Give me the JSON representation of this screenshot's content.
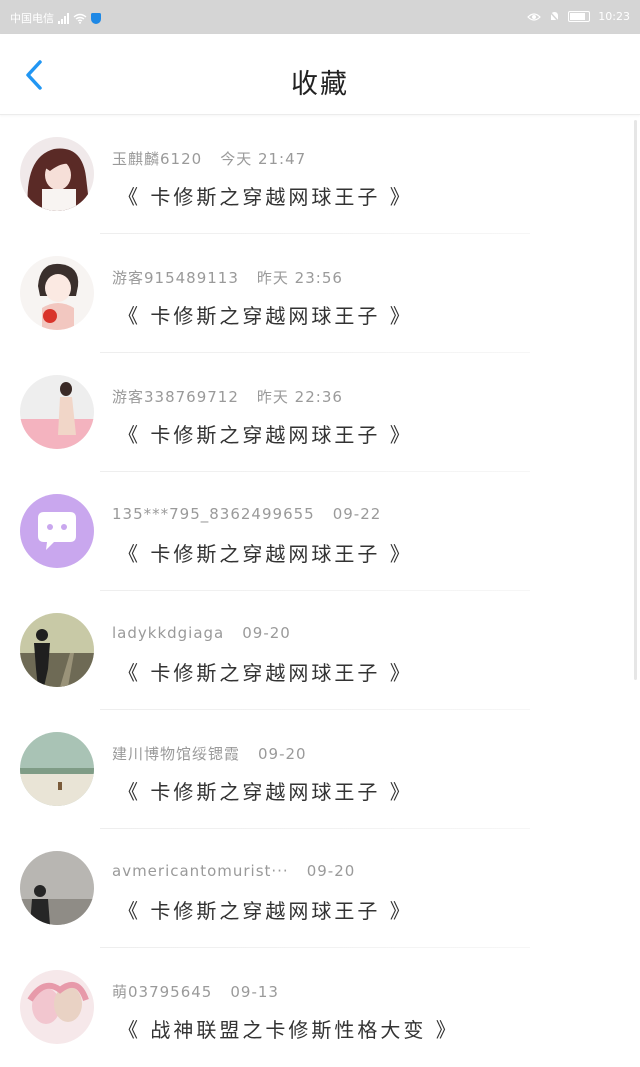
{
  "status_bar": {
    "carrier": "中国电信",
    "time": "10:23"
  },
  "header": {
    "title": "收藏"
  },
  "favorites": [
    {
      "user": "玉麒麟6120",
      "time": "今天 21:47",
      "book": "《 卡修斯之穿越网球王子 》",
      "avatar": "avatar-girl-brown-hair"
    },
    {
      "user": "游客915489113",
      "time": "昨天 23:56",
      "book": "《 卡修斯之穿越网球王子 》",
      "avatar": "avatar-anime-girl"
    },
    {
      "user": "游客338769712",
      "time": "昨天 22:36",
      "book": "《 卡修斯之穿越网球王子 》",
      "avatar": "avatar-girl-pink-text"
    },
    {
      "user": "135***795_8362499655",
      "time": "09-22",
      "book": "《 卡修斯之穿越网球王子 》",
      "avatar": "avatar-default-chat"
    },
    {
      "user": "ladykkdgiaga",
      "time": "09-20",
      "book": "《 卡修斯之穿越网球王子 》",
      "avatar": "avatar-man-railway"
    },
    {
      "user": "建川博物馆绥锶霞",
      "time": "09-20",
      "book": "《 卡修斯之穿越网球王子 》",
      "avatar": "avatar-landscape"
    },
    {
      "user": "avmericantomurist···",
      "time": "09-20",
      "book": "《 卡修斯之穿越网球王子 》",
      "avatar": "avatar-silhouette"
    },
    {
      "user": "萌03795645",
      "time": "09-13",
      "book": "《 战神联盟之卡修斯性格大变 》",
      "avatar": "avatar-anime-couple"
    }
  ],
  "colors": {
    "accent": "#2196f3",
    "status_bar": "#d5d5d5",
    "default_avatar": "#c9a7ee"
  }
}
